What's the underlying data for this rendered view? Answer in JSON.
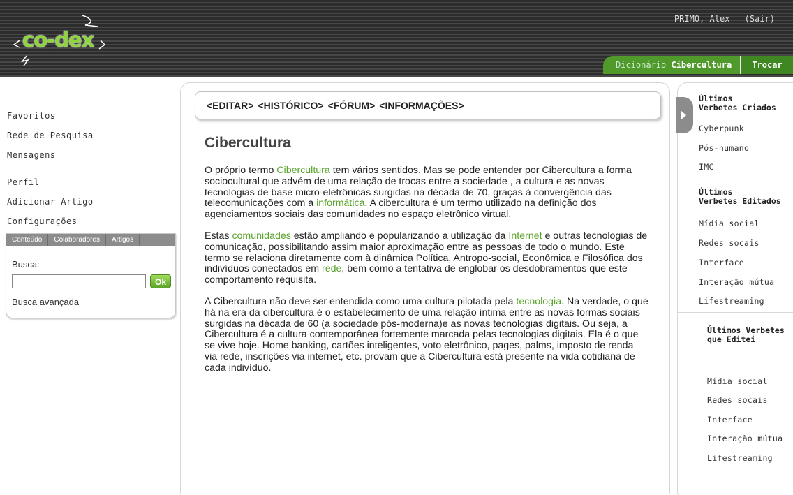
{
  "header": {
    "logo_text": "co-dex",
    "user_name": "PRIMO, Alex",
    "logout_label": "(Sair)",
    "dictionary_prefix": "Dicionário",
    "dictionary_name": "Cibercultura",
    "swap_label": "Trocar"
  },
  "left_nav": {
    "group1": [
      "Favoritos",
      "Rede de Pesquisa",
      "Mensagens"
    ],
    "group2": [
      "Perfil",
      "Adicionar Artigo",
      "Configurações"
    ]
  },
  "search": {
    "tabs": [
      "Conteúdo",
      "Colaboradores",
      "Artigos"
    ],
    "label": "Busca:",
    "value": "",
    "ok_label": "Ok",
    "advanced_label": "Busca avançada"
  },
  "actions": [
    "<EDITAR>",
    "<HISTÓRICO>",
    "<FÓRUM>",
    "<INFORMAÇÕES>"
  ],
  "article": {
    "title": "Cibercultura",
    "p1": {
      "t1": "O próprio termo ",
      "l1": "Cibercultura",
      "t2": " tem vários sentidos. Mas se pode entender por Cibercultura a forma sociocultural que advém de uma relação de trocas entre a sociedade , a cultura e as novas tecnologias de base micro-eletrônicas surgidas na década de 70, graças à convergência das telecomunicações com a ",
      "l2": "informática",
      "t3": ". A cibercultura é um termo utilizado na definição dos agenciamentos sociais das comunidades no espaço eletrônico virtual."
    },
    "p2": {
      "t1": "Estas ",
      "l1": "comunidades",
      "t2": " estão ampliando e popularizando a utilização da ",
      "l2": "Internet",
      "t3": " e outras tecnologias de comunicação, possibilitando assim maior aproximação entre as pessoas de todo o mundo. Este termo se relaciona diretamente com à dinâmica Política, Antropo-social, Econômica e Filosófica dos indivíduos conectados em ",
      "l3": "rede",
      "t4": ", bem como a tentativa de englobar os desdobramentos que este comportamento requisita."
    },
    "p3": {
      "t1": "A Cibercultura não deve ser entendida como uma cultura pilotada pela ",
      "l1": "tecnologia",
      "t2": ". Na verdade, o que há na era da cibercultura é o estabelecimento de uma relação íntima entre as novas formas sociais surgidas na década de 60 (a sociedade pós-moderna)e as novas tecnologias digitais. Ou seja, a Cibercultura é a cultura contemporânea fortemente marcada pelas tecnologias digitais. Ela é o que se vive hoje. Home banking, cartões inteligentes, voto eletrônico, pages, palms, imposto de renda via rede, inscrições via internet, etc. provam que a Cibercultura está presente na vida cotidiana de cada indivíduo."
    }
  },
  "right_sidebar": {
    "created": {
      "heading_l1": "Últimos",
      "heading_l2": "Verbetes Criados",
      "items": [
        "Cyberpunk",
        "Pós-humano",
        "IMC"
      ]
    },
    "edited": {
      "heading_l1": "Últimos",
      "heading_l2": "Verbetes Editados",
      "items": [
        "Mídia social",
        "Redes socais",
        "Interface",
        "Interação mútua",
        "Lifestreaming"
      ]
    },
    "mine": {
      "heading_l1": "Últimos Verbetes",
      "heading_l2": "que Editei",
      "items": [
        "Mídia social",
        "Redes socais",
        "Interface",
        "Interação mútua",
        "Lifestreaming"
      ]
    }
  },
  "colors": {
    "brand_green": "#5aa52c",
    "header_dark": "#333333",
    "dict_bar_green": "#4f9a2a"
  }
}
